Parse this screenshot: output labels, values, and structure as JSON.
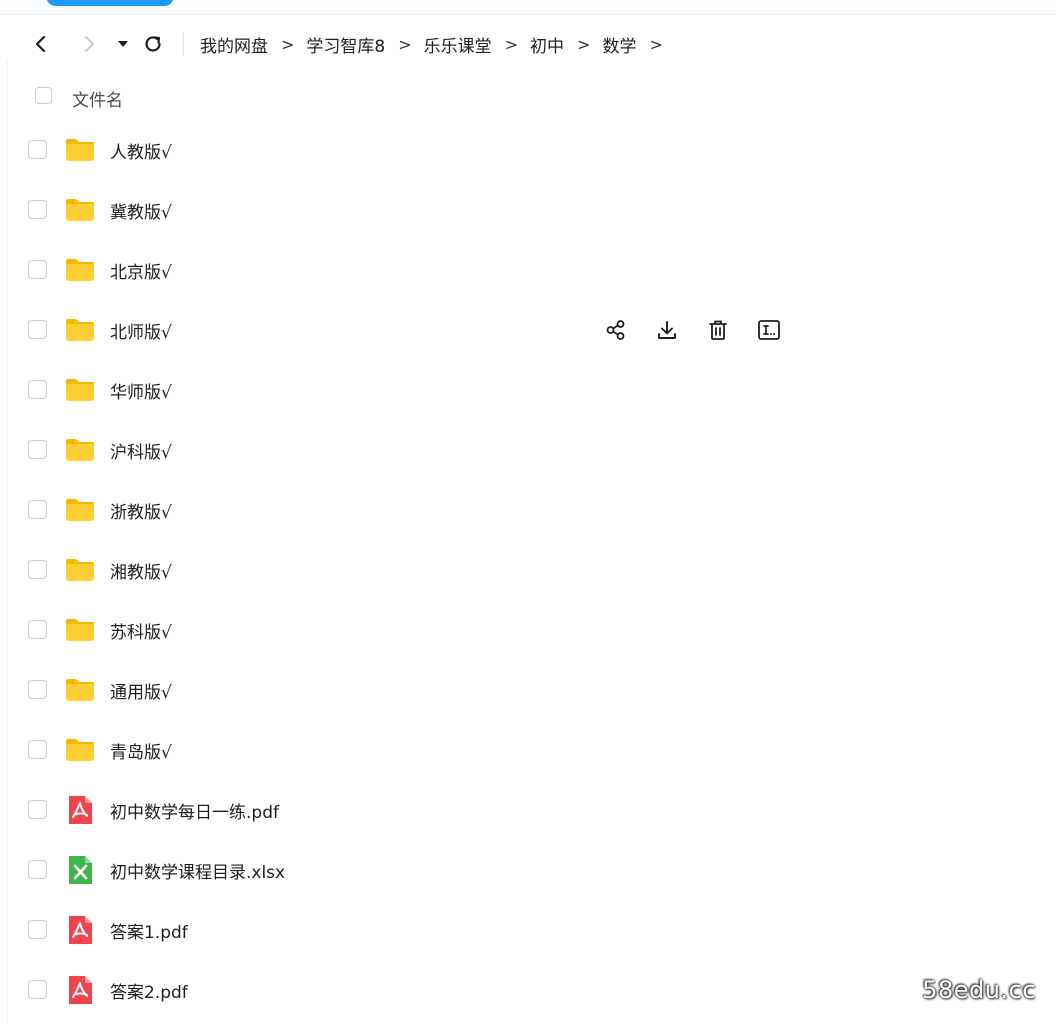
{
  "breadcrumb": [
    "我的网盘",
    "学习智库8",
    "乐乐课堂",
    "初中",
    "数学"
  ],
  "breadcrumb_separator": ">",
  "header": {
    "name_label": "文件名"
  },
  "files": [
    {
      "name": "人教版√",
      "type": "folder"
    },
    {
      "name": "冀教版√",
      "type": "folder"
    },
    {
      "name": "北京版√",
      "type": "folder"
    },
    {
      "name": "北师版√",
      "type": "folder",
      "hovered": true
    },
    {
      "name": "华师版√",
      "type": "folder"
    },
    {
      "name": "沪科版√",
      "type": "folder"
    },
    {
      "name": "浙教版√",
      "type": "folder"
    },
    {
      "name": "湘教版√",
      "type": "folder"
    },
    {
      "name": "苏科版√",
      "type": "folder"
    },
    {
      "name": "通用版√",
      "type": "folder"
    },
    {
      "name": "青岛版√",
      "type": "folder"
    },
    {
      "name": "初中数学每日一练.pdf",
      "type": "pdf"
    },
    {
      "name": "初中数学课程目录.xlsx",
      "type": "xlsx"
    },
    {
      "name": "答案1.pdf",
      "type": "pdf"
    },
    {
      "name": "答案2.pdf",
      "type": "pdf"
    }
  ],
  "row_actions": [
    "share-icon",
    "download-icon",
    "delete-icon",
    "rename-icon"
  ],
  "watermark": "58edu.cc",
  "colors": {
    "folder": "#ffcf33",
    "folder_tab": "#f5b800",
    "pdf": "#f0454f",
    "xlsx": "#3fb54a",
    "accent": "#1e9bff"
  }
}
